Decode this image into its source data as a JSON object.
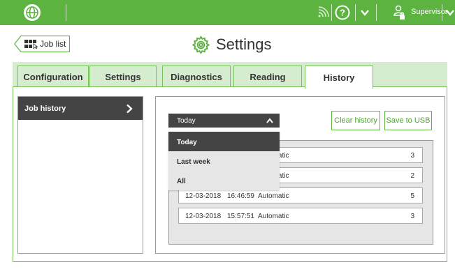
{
  "topbar": {
    "user_label": "Supervisor",
    "icons": [
      "globe-icon",
      "wifi-icon",
      "help-icon",
      "chevron-down-icon",
      "user-icon",
      "chevron-down-icon"
    ],
    "color": "#5cb33f"
  },
  "header": {
    "back_label": "Job list",
    "title": "Settings"
  },
  "tabs": [
    {
      "label": "Configuration"
    },
    {
      "label": "Settings"
    },
    {
      "label": "Diagnostics"
    },
    {
      "label": "Reading"
    },
    {
      "label": "History",
      "active": true
    }
  ],
  "sidebar": {
    "items": [
      {
        "label": "Job history",
        "selected": true
      }
    ]
  },
  "filter": {
    "selected": "Today",
    "options": [
      "Today",
      "Last week",
      "All"
    ]
  },
  "actions": {
    "clear_label": "Clear history",
    "save_label": "Save to USB"
  },
  "history_rows": [
    {
      "date": "",
      "time": "",
      "mode": "Automatic",
      "count": "3"
    },
    {
      "date": "",
      "time": "",
      "mode": "Automatic",
      "count": "2"
    },
    {
      "date": "12-03-2018",
      "time": "16:46:59",
      "mode": "Automatic",
      "count": "5"
    },
    {
      "date": "12-03-2018",
      "time": "15:57:51",
      "mode": "Automatic",
      "count": "3"
    }
  ]
}
